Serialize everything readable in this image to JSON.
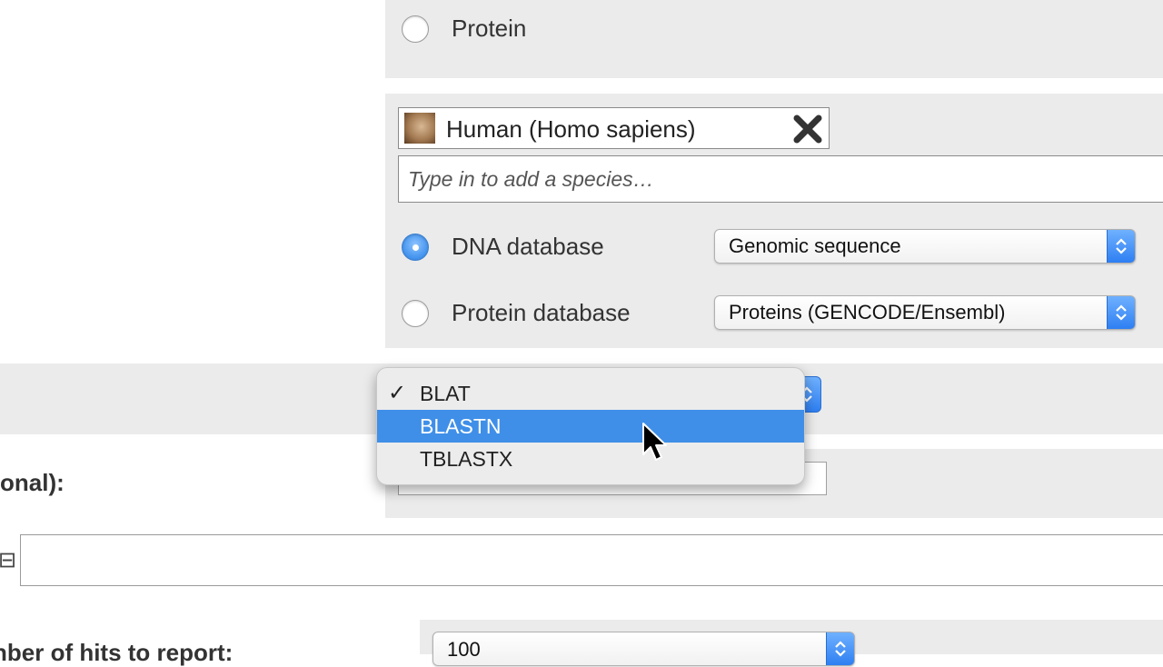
{
  "query_type": {
    "protein_label": "Protein"
  },
  "species": {
    "selected_tag": "Human (Homo sapiens)",
    "input_placeholder": "Type in to add a species…"
  },
  "database": {
    "dna_label": "DNA database",
    "dna_select_value": "Genomic sequence",
    "protein_label": "Protein database",
    "protein_select_value": "Proteins (GENCODE/Ensembl)",
    "selected": "dna"
  },
  "search_tool": {
    "options": [
      {
        "label": "BLAT",
        "checked": true
      },
      {
        "label": "BLASTN",
        "highlighted": true
      },
      {
        "label": "TBLASTX"
      }
    ]
  },
  "description": {
    "label_fragment": "onal):"
  },
  "options_section": {
    "toggle_glyph": "⊟"
  },
  "hits": {
    "label_fragment": "nber of hits to report:",
    "value": "100"
  }
}
